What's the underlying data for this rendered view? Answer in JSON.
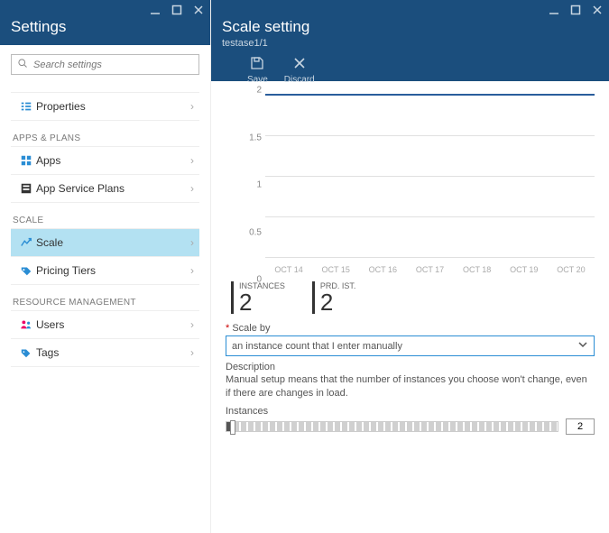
{
  "left": {
    "title": "Settings",
    "search_placeholder": "Search settings",
    "sections": {
      "top": [
        {
          "icon": "properties",
          "label": "Properties"
        }
      ],
      "apps_plans_label": "APPS & PLANS",
      "apps_plans": [
        {
          "icon": "apps",
          "label": "Apps"
        },
        {
          "icon": "appserviceplans",
          "label": "App Service Plans"
        }
      ],
      "scale_label": "SCALE",
      "scale": [
        {
          "icon": "scale",
          "label": "Scale",
          "selected": true
        },
        {
          "icon": "pricing",
          "label": "Pricing Tiers"
        }
      ],
      "resource_label": "RESOURCE MANAGEMENT",
      "resource": [
        {
          "icon": "users",
          "label": "Users"
        },
        {
          "icon": "tags",
          "label": "Tags"
        }
      ]
    }
  },
  "right": {
    "title": "Scale setting",
    "subtitle": "testase1/1",
    "toolbar": {
      "save": "Save",
      "discard": "Discard"
    },
    "chart": {
      "y_ticks": [
        "0",
        "0.5",
        "1",
        "1.5",
        "2"
      ],
      "x_ticks": [
        "OCT 14",
        "OCT 15",
        "OCT 16",
        "OCT 17",
        "OCT 18",
        "OCT 19",
        "OCT 20"
      ]
    },
    "stats": {
      "instances_label": "INSTANCES",
      "instances_value": "2",
      "prdist_label": "PRD. IST.",
      "prdist_value": "2"
    },
    "scaleby_label": "Scale by",
    "scaleby_value": "an instance count that I enter manually",
    "description_label": "Description",
    "description_text": "Manual setup means that the number of instances you choose won't change, even if there are changes in load.",
    "instances_label": "Instances",
    "instances_value": "2"
  },
  "chart_data": {
    "type": "line",
    "x": [
      "OCT 14",
      "OCT 15",
      "OCT 16",
      "OCT 17",
      "OCT 18",
      "OCT 19",
      "OCT 20"
    ],
    "series": [
      {
        "name": "Instances",
        "values": [
          2,
          2,
          2,
          2,
          2,
          2,
          2
        ]
      }
    ],
    "ylim": [
      0,
      2
    ],
    "y_ticks": [
      0,
      0.5,
      1,
      1.5,
      2
    ],
    "xlabel": "",
    "ylabel": ""
  }
}
